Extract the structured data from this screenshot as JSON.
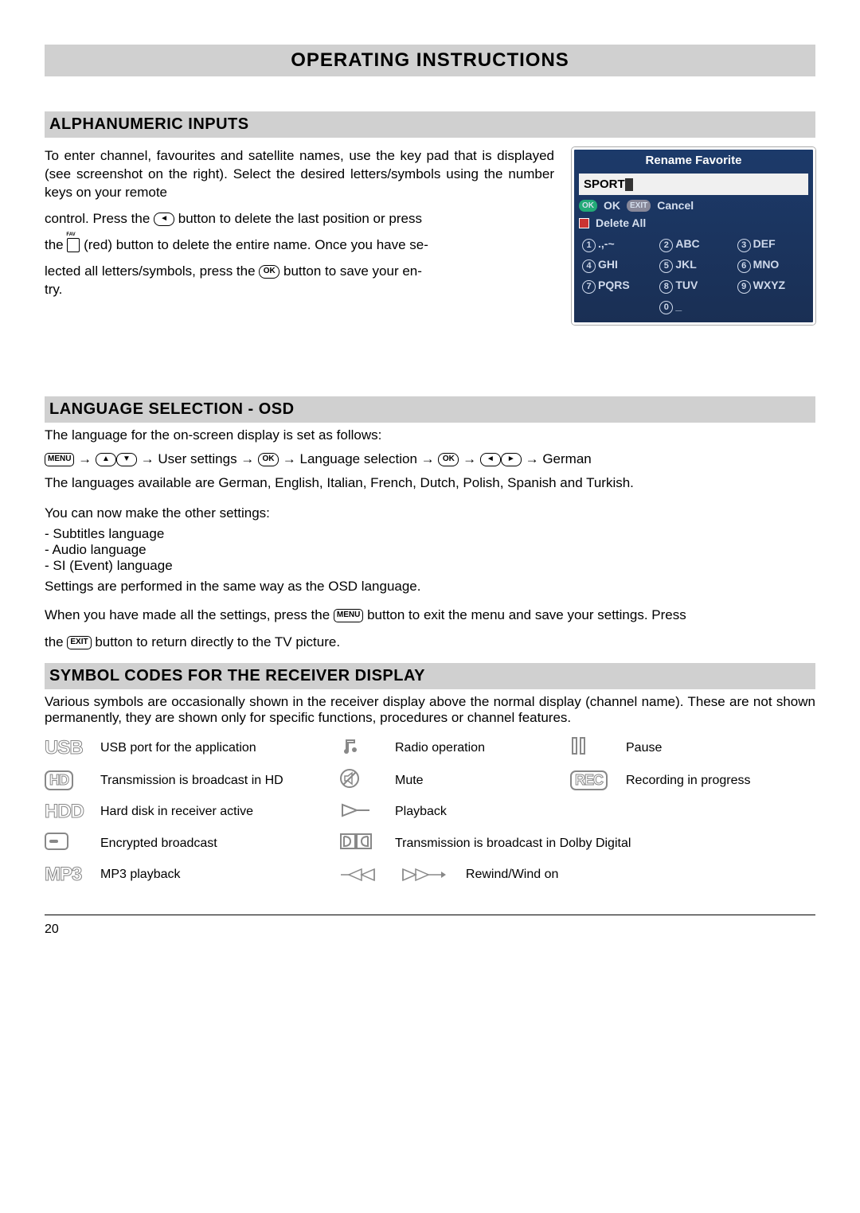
{
  "header": {
    "title": "OPERATING INSTRUCTIONS"
  },
  "sections": {
    "alnum": {
      "heading": "ALPHANUMERIC INPUTS",
      "p1a": "To enter channel, favourites and satellite names, use the key pad that is displayed (see screenshot on the right). Select the desired letters/symbols using the number keys on your remote",
      "p1b": "control. Press the ",
      "p1c": " button to delete the last position or press",
      "p2a": "the ",
      "p2b": "(red) button to delete the entire name. Once you have se-",
      "p3a": "lected all letters/symbols, press the ",
      "p3b": " button to save your en-",
      "p3c": "try.",
      "screenshot": {
        "title": "Rename Favorite",
        "inputValue": "SPORT",
        "ok": "OK",
        "cancel": "Cancel",
        "deleteAll": "Delete All",
        "keypad": [
          {
            "n": "1",
            "t": ".,-~"
          },
          {
            "n": "2",
            "t": "ABC"
          },
          {
            "n": "3",
            "t": "DEF"
          },
          {
            "n": "4",
            "t": "GHI"
          },
          {
            "n": "5",
            "t": "JKL"
          },
          {
            "n": "6",
            "t": "MNO"
          },
          {
            "n": "7",
            "t": "PQRS"
          },
          {
            "n": "8",
            "t": "TUV"
          },
          {
            "n": "9",
            "t": "WXYZ"
          },
          {
            "n": "",
            "t": ""
          },
          {
            "n": "0",
            "t": "_"
          },
          {
            "n": "",
            "t": ""
          }
        ]
      }
    },
    "lang": {
      "heading": "LANGUAGE SELECTION - OSD",
      "intro": "The language for the on-screen display is set as follows:",
      "nav_user": " User settings ",
      "nav_lang": " Language selection ",
      "nav_german": " German",
      "availLine": "The languages available are German, English, Italian, French, Dutch, Polish, Spanish and Turkish.",
      "other": "You can now make the other settings:",
      "items": [
        "Subtitles language",
        "Audio language",
        "SI (Event) language"
      ],
      "sameWay": "Settings are performed in the same way as the OSD language.",
      "pressMenuA": "When you have made all the settings, press the ",
      "pressMenuB": " button to exit the menu and save your settings. Press",
      "pressExitA": "the ",
      "pressExitB": " button to return directly to the TV picture."
    },
    "symcodes": {
      "heading": "SYMBOL CODES FOR THE RECEIVER DISPLAY",
      "intro": "Various symbols are occasionally shown in the receiver display above the normal display (channel name). These are not shown permanently, they are shown only for specific functions, procedures or channel features.",
      "items": {
        "usb": "USB port for the application",
        "hd": "Transmission is broadcast in HD",
        "hdd": "Hard disk in receiver active",
        "enc": "Encrypted broadcast",
        "mp3": "MP3 playback",
        "radio": "Radio operation",
        "mute": "Mute",
        "play": "Playback",
        "dolby": "Transmission is broadcast in Dolby Digital",
        "rewind": "Rewind/Wind on",
        "pause": "Pause",
        "rec": "Recording in progress"
      },
      "labels": {
        "usb": "USB",
        "hd": "HD",
        "hdd": "HDD",
        "mp3": "MP3",
        "rec": "REC"
      }
    }
  },
  "footer": {
    "page": "20"
  },
  "buttons": {
    "menu": "MENU",
    "ok": "OK",
    "exit": "EXIT"
  }
}
